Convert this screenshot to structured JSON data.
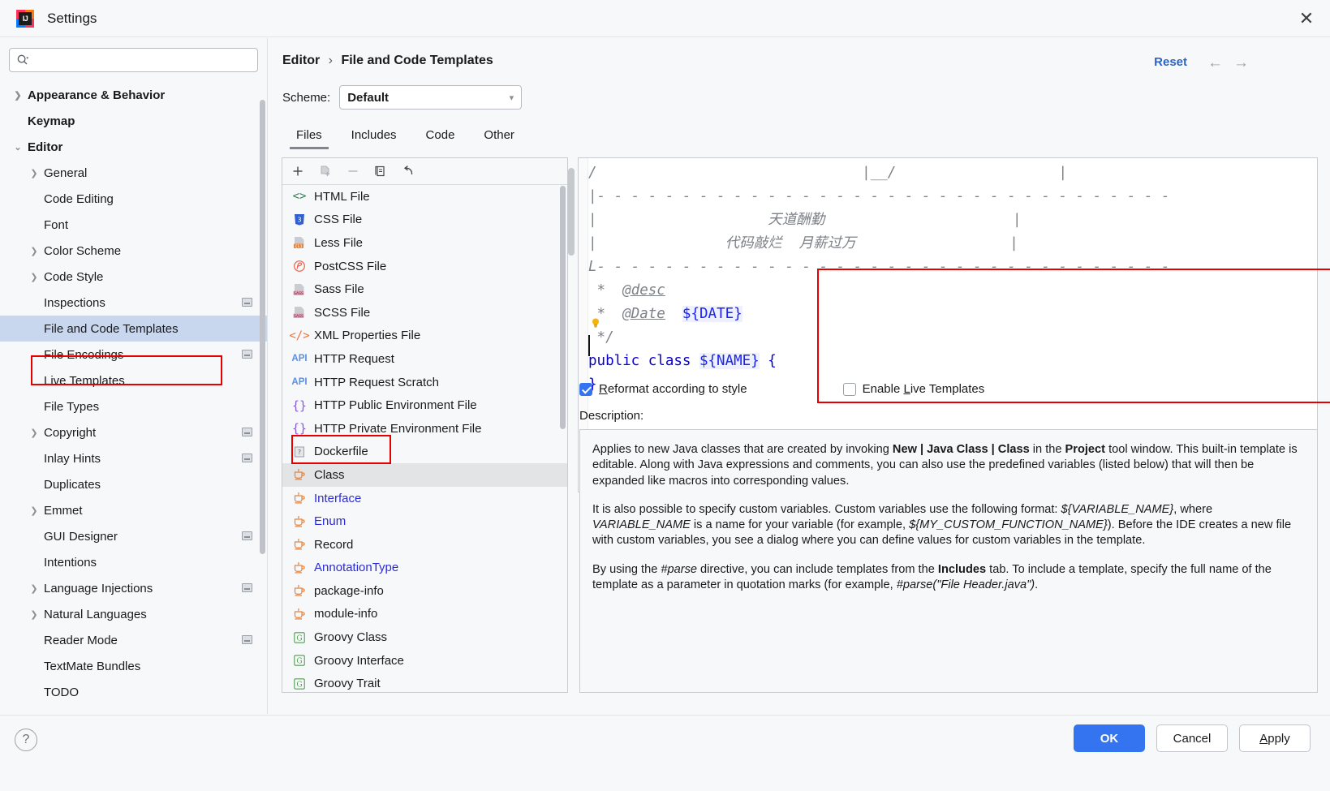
{
  "window": {
    "title": "Settings",
    "app_icon": "intellij-idea-icon",
    "close_icon": "close-icon"
  },
  "sidebar": {
    "search": {
      "placeholder": "",
      "value": "",
      "icon": "search-icon"
    },
    "items": [
      {
        "label": "Appearance & Behavior",
        "level": 0,
        "arrow": "›",
        "bold": true,
        "badge": false,
        "selected": false
      },
      {
        "label": "Keymap",
        "level": 0,
        "arrow": "",
        "bold": true,
        "badge": false,
        "selected": false
      },
      {
        "label": "Editor",
        "level": 0,
        "arrow": "⌄",
        "bold": true,
        "badge": false,
        "selected": false
      },
      {
        "label": "General",
        "level": 1,
        "arrow": "›",
        "bold": false,
        "badge": false,
        "selected": false
      },
      {
        "label": "Code Editing",
        "level": 1,
        "arrow": "",
        "bold": false,
        "badge": false,
        "selected": false
      },
      {
        "label": "Font",
        "level": 1,
        "arrow": "",
        "bold": false,
        "badge": false,
        "selected": false
      },
      {
        "label": "Color Scheme",
        "level": 1,
        "arrow": "›",
        "bold": false,
        "badge": false,
        "selected": false
      },
      {
        "label": "Code Style",
        "level": 1,
        "arrow": "›",
        "bold": false,
        "badge": false,
        "selected": false
      },
      {
        "label": "Inspections",
        "level": 1,
        "arrow": "",
        "bold": false,
        "badge": true,
        "selected": false
      },
      {
        "label": "File and Code Templates",
        "level": 1,
        "arrow": "",
        "bold": false,
        "badge": false,
        "selected": true
      },
      {
        "label": "File Encodings",
        "level": 1,
        "arrow": "",
        "bold": false,
        "badge": true,
        "selected": false
      },
      {
        "label": "Live Templates",
        "level": 1,
        "arrow": "",
        "bold": false,
        "badge": false,
        "selected": false
      },
      {
        "label": "File Types",
        "level": 1,
        "arrow": "",
        "bold": false,
        "badge": false,
        "selected": false
      },
      {
        "label": "Copyright",
        "level": 1,
        "arrow": "›",
        "bold": false,
        "badge": true,
        "selected": false
      },
      {
        "label": "Inlay Hints",
        "level": 1,
        "arrow": "",
        "bold": false,
        "badge": true,
        "selected": false
      },
      {
        "label": "Duplicates",
        "level": 1,
        "arrow": "",
        "bold": false,
        "badge": false,
        "selected": false
      },
      {
        "label": "Emmet",
        "level": 1,
        "arrow": "›",
        "bold": false,
        "badge": false,
        "selected": false
      },
      {
        "label": "GUI Designer",
        "level": 1,
        "arrow": "",
        "bold": false,
        "badge": true,
        "selected": false
      },
      {
        "label": "Intentions",
        "level": 1,
        "arrow": "",
        "bold": false,
        "badge": false,
        "selected": false
      },
      {
        "label": "Language Injections",
        "level": 1,
        "arrow": "›",
        "bold": false,
        "badge": true,
        "selected": false
      },
      {
        "label": "Natural Languages",
        "level": 1,
        "arrow": "›",
        "bold": false,
        "badge": false,
        "selected": false
      },
      {
        "label": "Reader Mode",
        "level": 1,
        "arrow": "",
        "bold": false,
        "badge": true,
        "selected": false
      },
      {
        "label": "TextMate Bundles",
        "level": 1,
        "arrow": "",
        "bold": false,
        "badge": false,
        "selected": false
      },
      {
        "label": "TODO",
        "level": 1,
        "arrow": "",
        "bold": false,
        "badge": false,
        "selected": false
      }
    ]
  },
  "header": {
    "breadcrumb_root": "Editor",
    "breadcrumb_sep": "›",
    "breadcrumb_leaf": "File and Code Templates",
    "reset_label": "Reset",
    "back_icon": "arrow-left-icon",
    "forward_icon": "arrow-right-icon"
  },
  "scheme": {
    "label": "Scheme:",
    "value": "Default",
    "chevron_icon": "chevron-down-icon"
  },
  "tabs": [
    {
      "label": "Files",
      "active": true
    },
    {
      "label": "Includes",
      "active": false
    },
    {
      "label": "Code",
      "active": false
    },
    {
      "label": "Other",
      "active": false
    }
  ],
  "template_toolbar": [
    {
      "icon": "plus-icon",
      "name": "add-template-button",
      "enabled": true
    },
    {
      "icon": "copy-template-icon",
      "name": "copy-template-button",
      "enabled": false
    },
    {
      "icon": "minus-icon",
      "name": "remove-template-button",
      "enabled": false
    },
    {
      "icon": "clone-icon",
      "name": "duplicate-template-button",
      "enabled": true
    },
    {
      "icon": "revert-icon",
      "name": "reset-template-button",
      "enabled": true
    }
  ],
  "templates": [
    {
      "label": "HTML File",
      "icon": "html-icon",
      "blue": false,
      "selected": false
    },
    {
      "label": "CSS File",
      "icon": "css-icon",
      "blue": false,
      "selected": false
    },
    {
      "label": "Less File",
      "icon": "less-icon",
      "blue": false,
      "selected": false
    },
    {
      "label": "PostCSS File",
      "icon": "postcss-icon",
      "blue": false,
      "selected": false
    },
    {
      "label": "Sass File",
      "icon": "sass-icon",
      "blue": false,
      "selected": false
    },
    {
      "label": "SCSS File",
      "icon": "scss-icon",
      "blue": false,
      "selected": false
    },
    {
      "label": "XML Properties File",
      "icon": "xml-icon",
      "blue": false,
      "selected": false
    },
    {
      "label": "HTTP Request",
      "icon": "api-icon",
      "blue": false,
      "selected": false
    },
    {
      "label": "HTTP Request Scratch",
      "icon": "api-icon",
      "blue": false,
      "selected": false
    },
    {
      "label": "HTTP Public Environment File",
      "icon": "braces-icon",
      "blue": false,
      "selected": false
    },
    {
      "label": "HTTP Private Environment File",
      "icon": "braces-icon",
      "blue": false,
      "selected": false
    },
    {
      "label": "Dockerfile",
      "icon": "unknown-file-icon",
      "blue": false,
      "selected": false
    },
    {
      "label": "Class",
      "icon": "java-icon",
      "blue": false,
      "selected": true
    },
    {
      "label": "Interface",
      "icon": "java-icon",
      "blue": true,
      "selected": false
    },
    {
      "label": "Enum",
      "icon": "java-icon",
      "blue": true,
      "selected": false
    },
    {
      "label": "Record",
      "icon": "java-icon",
      "blue": false,
      "selected": false
    },
    {
      "label": "AnnotationType",
      "icon": "java-icon",
      "blue": true,
      "selected": false
    },
    {
      "label": "package-info",
      "icon": "java-icon",
      "blue": false,
      "selected": false
    },
    {
      "label": "module-info",
      "icon": "java-icon",
      "blue": false,
      "selected": false
    },
    {
      "label": "Groovy Class",
      "icon": "groovy-icon",
      "blue": false,
      "selected": false
    },
    {
      "label": "Groovy Interface",
      "icon": "groovy-icon",
      "blue": false,
      "selected": false
    },
    {
      "label": "Groovy Trait",
      "icon": "groovy-icon",
      "blue": false,
      "selected": false
    }
  ],
  "editor": {
    "lines": [
      {
        "segments": [
          {
            "t": "/",
            "c": "cmt"
          },
          {
            "t": "                               ",
            "c": "plain"
          },
          {
            "t": "|__/",
            "c": "cmt"
          },
          {
            "t": "                   ",
            "c": "plain"
          },
          {
            "t": "|",
            "c": "cmt"
          }
        ]
      },
      {
        "segments": [
          {
            "t": "|- - - - - - - - - - - - - - - - - - - - - - - - - - - - - - - - - -",
            "c": "cmt"
          }
        ]
      },
      {
        "segments": [
          {
            "t": "|                    天道酬勤                      |",
            "c": "cn"
          }
        ]
      },
      {
        "segments": [
          {
            "t": "|               代码敲烂  月薪过万                  |",
            "c": "cn"
          }
        ]
      },
      {
        "segments": [
          {
            "t": "L- - - - - - - - - - - - - - - - - - - - - - - - - - - - - - - - - -",
            "c": "cmt"
          }
        ]
      },
      {
        "segments": [
          {
            "t": " *  ",
            "c": "cmt"
          },
          {
            "t": "@desc",
            "c": "tag"
          }
        ]
      },
      {
        "segments": [
          {
            "t": " *  ",
            "c": "cmt"
          },
          {
            "t": "@Date",
            "c": "tag"
          },
          {
            "t": "  ",
            "c": "plain"
          },
          {
            "t": "${DATE}",
            "c": "var"
          }
        ]
      },
      {
        "segments": [
          {
            "t": " */",
            "c": "cmt"
          }
        ]
      },
      {
        "segments": [
          {
            "t": "public class ",
            "c": "kw"
          },
          {
            "t": "${NAME}",
            "c": "var"
          },
          {
            "t": " {",
            "c": "kw"
          }
        ]
      },
      {
        "segments": [
          {
            "t": "}",
            "c": "kw"
          }
        ]
      }
    ],
    "bulb_icon": "lightbulb-icon"
  },
  "options": {
    "reformat": {
      "label": "Reformat according to style",
      "mnemonic": "R",
      "rest": "eformat according to style",
      "checked": true
    },
    "live_templates": {
      "label": "Enable Live Templates",
      "prefix": "Enable ",
      "mnemonic": "L",
      "rest": "ive Templates",
      "checked": false
    }
  },
  "description": {
    "label": "Description:",
    "paragraphs": [
      "Applies to new Java classes that are created by invoking <b>New | Java Class | Class</b> in the <b>Project</b> tool window. This built-in template is editable. Along with Java expressions and comments, you can also use the predefined variables (listed below) that will then be expanded like macros into corresponding values.",
      "It is also possible to specify custom variables. Custom variables use the following format: <i>${VARIABLE_NAME}</i>, where <i>VARIABLE_NAME</i> is a name for your variable (for example, <i>${MY_CUSTOM_FUNCTION_NAME}</i>). Before the IDE creates a new file with custom variables, you see a dialog where you can define values for custom variables in the template.",
      "By using the <i>#parse</i> directive, you can include templates from the <b>Includes</b> tab. To include a template, specify the full name of the template as a parameter in quotation marks (for example, <i>#parse(\"File Header.java\")</i>."
    ]
  },
  "footer": {
    "help_label": "?",
    "ok_label": "OK",
    "cancel_label": "Cancel",
    "apply_mnemonic": "A",
    "apply_rest": "pply"
  },
  "colors": {
    "accent": "#3574f0",
    "link": "#2f63c4",
    "highlight_box": "#e60000",
    "selection": "#c8d6ee",
    "list_selection": "#e3e4e6"
  }
}
